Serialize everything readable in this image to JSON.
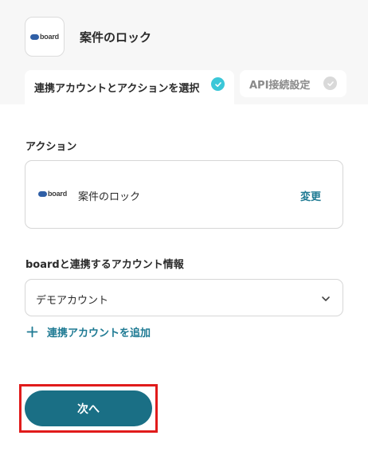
{
  "header": {
    "app_logo_text": "board",
    "title": "案件のロック"
  },
  "tabs": [
    {
      "label": "連携アカウントとアクションを選択",
      "state": "completed"
    },
    {
      "label": "API接続設定",
      "state": "pending"
    }
  ],
  "action_section": {
    "label": "アクション",
    "app_logo_text": "board",
    "action_name": "案件のロック",
    "change_label": "変更"
  },
  "account_section": {
    "label": "boardと連携するアカウント情報",
    "selected_account": "デモアカウント",
    "add_account_label": "連携アカウントを追加"
  },
  "footer": {
    "next_label": "次へ"
  },
  "colors": {
    "accent": "#1a6f85",
    "link": "#1e7a93",
    "check_active": "#3bc7d8",
    "highlight": "#e01b1b"
  }
}
